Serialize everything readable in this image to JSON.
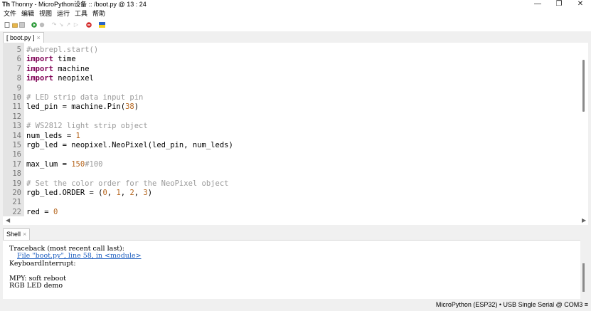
{
  "window": {
    "title": "Thonny  -  MicroPython设备 :: /boot.py  @  13 : 24",
    "app_icon": "Th",
    "controls": {
      "minimize": "—",
      "maximize": "❐",
      "close": "✕"
    }
  },
  "menu": [
    "文件",
    "编辑",
    "视图",
    "运行",
    "工具",
    "帮助"
  ],
  "toolbar": {
    "icons": [
      "new-file-icon",
      "open-file-icon",
      "save-icon",
      "run-icon",
      "debug-icon",
      "step-over-icon",
      "step-into-icon",
      "step-out-icon",
      "resume-icon",
      "stop-icon",
      "ukraine-flag-icon"
    ],
    "colors": {
      "run": "#2e9b3a",
      "stop": "#d42a2a",
      "flag_top": "#2a64c8",
      "flag_bottom": "#f5cf1a"
    }
  },
  "editor": {
    "tab_label": "[ boot.py ]",
    "tab_close": "×",
    "lines": [
      {
        "n": "5",
        "segs": [
          {
            "t": "#webrepl.start()",
            "c": "com"
          }
        ]
      },
      {
        "n": "6",
        "segs": [
          {
            "t": "import",
            "c": "kw"
          },
          {
            "t": " time",
            "c": ""
          }
        ]
      },
      {
        "n": "7",
        "segs": [
          {
            "t": "import",
            "c": "kw"
          },
          {
            "t": " machine",
            "c": ""
          }
        ]
      },
      {
        "n": "8",
        "segs": [
          {
            "t": "import",
            "c": "kw"
          },
          {
            "t": " neopixel",
            "c": ""
          }
        ]
      },
      {
        "n": "9",
        "segs": []
      },
      {
        "n": "10",
        "segs": [
          {
            "t": "# LED strip data input pin",
            "c": "com"
          }
        ]
      },
      {
        "n": "11",
        "segs": [
          {
            "t": "led_pin = machine.Pin(",
            "c": ""
          },
          {
            "t": "38",
            "c": "num"
          },
          {
            "t": ")",
            "c": ""
          }
        ]
      },
      {
        "n": "12",
        "segs": []
      },
      {
        "n": "13",
        "segs": [
          {
            "t": "# WS2812 light strip object",
            "c": "com"
          }
        ]
      },
      {
        "n": "14",
        "segs": [
          {
            "t": "num_leds = ",
            "c": ""
          },
          {
            "t": "1",
            "c": "num"
          }
        ]
      },
      {
        "n": "15",
        "segs": [
          {
            "t": "rgb_led = neopixel.NeoPixel(led_pin, num_leds)",
            "c": ""
          }
        ]
      },
      {
        "n": "16",
        "segs": []
      },
      {
        "n": "17",
        "segs": [
          {
            "t": "max_lum = ",
            "c": ""
          },
          {
            "t": "150",
            "c": "num"
          },
          {
            "t": "#100",
            "c": "com"
          }
        ]
      },
      {
        "n": "18",
        "segs": []
      },
      {
        "n": "19",
        "segs": [
          {
            "t": "# Set the color order for the NeoPixel object",
            "c": "com"
          }
        ]
      },
      {
        "n": "20",
        "segs": [
          {
            "t": "rgb_led.ORDER = (",
            "c": ""
          },
          {
            "t": "0",
            "c": "num"
          },
          {
            "t": ", ",
            "c": ""
          },
          {
            "t": "1",
            "c": "num"
          },
          {
            "t": ", ",
            "c": ""
          },
          {
            "t": "2",
            "c": "num"
          },
          {
            "t": ", ",
            "c": ""
          },
          {
            "t": "3",
            "c": "num"
          },
          {
            "t": ")",
            "c": ""
          }
        ]
      },
      {
        "n": "21",
        "segs": []
      },
      {
        "n": "22",
        "segs": [
          {
            "t": "red = ",
            "c": ""
          },
          {
            "t": "0",
            "c": "num"
          }
        ]
      }
    ]
  },
  "shell": {
    "tab_label": "Shell",
    "tab_close": "×",
    "lines": [
      {
        "t": "Traceback (most recent call last):",
        "link": false
      },
      {
        "t": "File \"boot.py\", line 58, in <module>",
        "link": true
      },
      {
        "t": "KeyboardInterrupt:",
        "link": false
      },
      {
        "t": "",
        "link": false
      },
      {
        "t": "MPY: soft reboot",
        "link": false
      },
      {
        "t": "RGB LED demo",
        "link": false
      }
    ]
  },
  "status": {
    "interpreter": "MicroPython (ESP32)  •  USB Single Serial @ COM3  ≡"
  }
}
